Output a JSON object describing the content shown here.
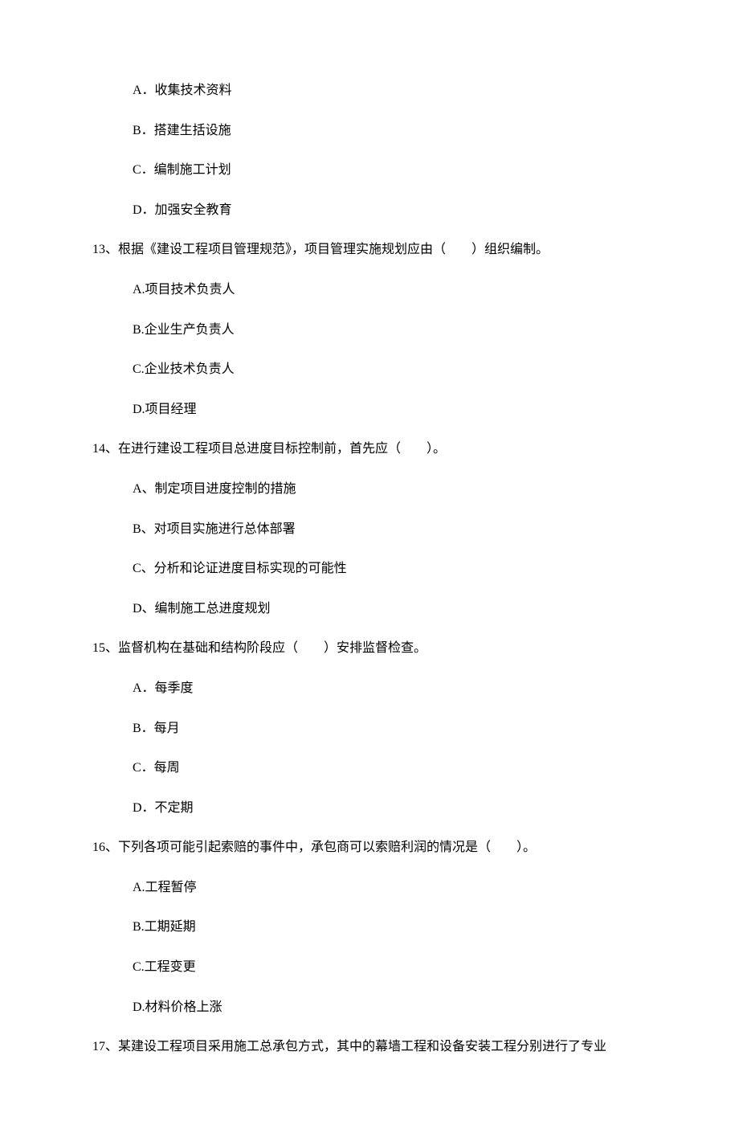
{
  "q12_options": {
    "a": "A．收集技术资料",
    "b": "B．搭建生括设施",
    "c": "C．编制施工计划",
    "d": "D．加强安全教育"
  },
  "q13": {
    "text": "13、根据《建设工程项目管理规范》，项目管理实施规划应由（　　）组织编制。",
    "a": "A.项目技术负责人",
    "b": "B.企业生产负责人",
    "c": "C.企业技术负责人",
    "d": "D.项目经理"
  },
  "q14": {
    "text": "14、在进行建设工程项目总进度目标控制前，首先应（　　）。",
    "a": "A、制定项目进度控制的措施",
    "b": "B、对项目实施进行总体部署",
    "c": "C、分析和论证进度目标实现的可能性",
    "d": "D、编制施工总进度规划"
  },
  "q15": {
    "text": "15、监督机构在基础和结构阶段应（　　）安排监督检查。",
    "a": "A．每季度",
    "b": "B．每月",
    "c": "C．每周",
    "d": "D．不定期"
  },
  "q16": {
    "text": "16、下列各项可能引起索赔的事件中，承包商可以索赔利润的情况是（　　）。",
    "a": "A.工程暂停",
    "b": "B.工期延期",
    "c": "C.工程变更",
    "d": "D.材料价格上涨"
  },
  "q17": {
    "text": "17、某建设工程项目采用施工总承包方式，其中的幕墙工程和设备安装工程分别进行了专业"
  }
}
